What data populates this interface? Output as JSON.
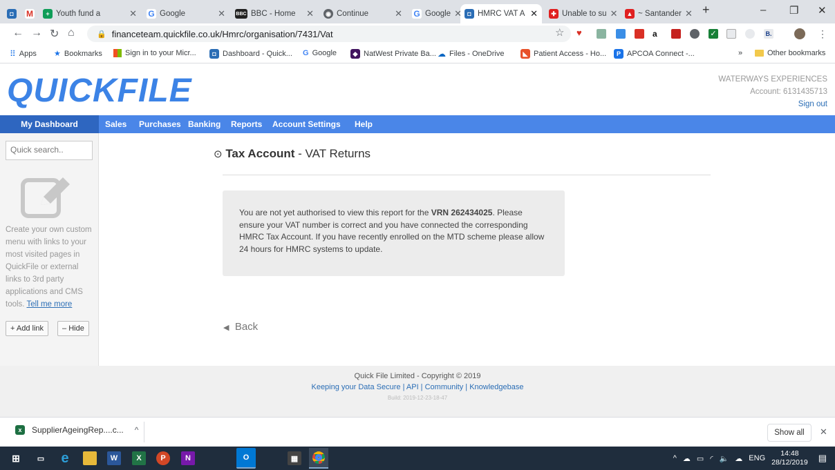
{
  "browser": {
    "tabs": [
      {
        "label": "",
        "icon": "quickfile-icon"
      },
      {
        "label": "",
        "icon": "gmail-icon"
      },
      {
        "label": "Youth fund a",
        "icon": "forms-icon"
      },
      {
        "label": "Google",
        "icon": "google-icon"
      },
      {
        "label": "BBC - Home",
        "icon": "bbc-icon"
      },
      {
        "label": "Continue",
        "icon": "globe-icon"
      },
      {
        "label": "Google",
        "icon": "google-icon"
      },
      {
        "label": "HMRC VAT A",
        "icon": "quickfile-icon"
      },
      {
        "label": "Unable to su",
        "icon": "community-icon"
      },
      {
        "label": "~ Santander",
        "icon": "santander-icon"
      }
    ],
    "url": "financeteam.quickfile.co.uk/Hmrc/organisation/7431/Vat",
    "bookmarks": [
      "Apps",
      "Bookmarks",
      "Sign in to your Micr...",
      "Dashboard - Quick...",
      "Google",
      "NatWest Private Ba...",
      "Files - OneDrive",
      "Patient Access - Ho...",
      "APCOA Connect -..."
    ],
    "other_bookmarks": "Other bookmarks",
    "chevron": "»"
  },
  "header": {
    "logo": "QUICKFILE",
    "company": "WATERWAYS EXPERIENCES",
    "account": "Account: 6131435713",
    "signout": "Sign out"
  },
  "nav": [
    "My Dashboard",
    "Sales",
    "Purchases",
    "Banking",
    "Reports",
    "Account Settings",
    "Help"
  ],
  "sidebar": {
    "search_placeholder": "Quick search..",
    "text": "Create your own custom menu with links to your most visited pages in QuickFile or external links to 3rd party applications and CMS tools.",
    "tell_more": "Tell me more",
    "add_link": "Add link",
    "hide": "Hide"
  },
  "main": {
    "title_bold": "Tax Account",
    "title_rest": " - VAT Returns",
    "notice_pre": "You are not yet authorised to view this report for the ",
    "notice_vrn": "VRN 262434025",
    "notice_post": ". Please ensure your VAT number is correct and you have connected the corresponding HMRC Tax Account. If you have recently enrolled on the MTD scheme please allow 24 hours for HMRC systems to update.",
    "back": "Back"
  },
  "footer": {
    "copyright": "Quick File Limited - Copyright © 2019",
    "links": [
      "Keeping your Data Secure",
      "API",
      "Community",
      "Knowledgebase"
    ],
    "build": "Build: 2019-12-23-18-47"
  },
  "download": {
    "file": "SupplierAgeingRep....c...",
    "show_all": "Show all"
  },
  "taskbar": {
    "lang": "ENG",
    "time": "14:48",
    "date": "28/12/2019"
  },
  "colors": {
    "brand": "#3c83e6",
    "nav": "#4a86e8",
    "nav_selected": "#2e66c0",
    "link": "#2a6db5"
  }
}
